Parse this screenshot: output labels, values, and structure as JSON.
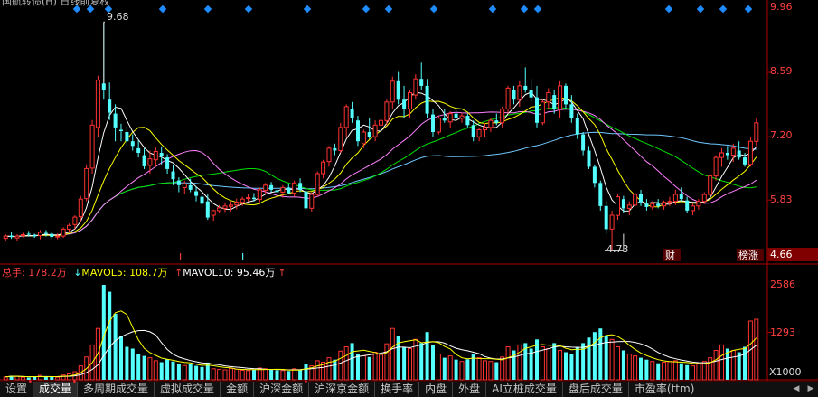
{
  "title": "国航转债(H) 日线前复权",
  "colors": {
    "up": "#ff3232",
    "down": "#54ffff",
    "axis": "#b00000",
    "ma5": "#ffffff",
    "ma10": "#ffff00",
    "ma20": "#ff80ff",
    "ma30": "#00e000",
    "ma60": "#6ec8ff"
  },
  "price_axis": {
    "top_label": "9.96",
    "ticks": [
      "8.59",
      "7.20",
      "5.83"
    ],
    "bottom_label": "4.66"
  },
  "annotations": {
    "high": "9.68",
    "low": "4.73"
  },
  "markers": {
    "L1": "L",
    "L2": "L"
  },
  "badges": {
    "cai": "财",
    "bang": "榜涨"
  },
  "volume_legend": {
    "total_label": "总手",
    "total_value": "178.2万",
    "ma5_label": "MAVOL5",
    "ma5_value": "108.7万",
    "ma10_label": "MAVOL10",
    "ma10_value": "95.46万"
  },
  "volume_axis": {
    "top_label": "2586",
    "mid_label": "1293",
    "unit_label": "X1000"
  },
  "tabs": [
    {
      "label": "设置",
      "marked": true
    },
    {
      "label": "成交量",
      "marked": true,
      "active": true
    },
    {
      "label": "多周期成交量",
      "marked": false
    },
    {
      "label": "虚拟成交量",
      "marked": false
    },
    {
      "label": "金额",
      "marked": false
    },
    {
      "label": "沪深金额",
      "marked": true
    },
    {
      "label": "沪深京金额",
      "marked": false
    },
    {
      "label": "换手率",
      "marked": false
    },
    {
      "label": "内盘",
      "marked": false
    },
    {
      "label": "外盘",
      "marked": false
    },
    {
      "label": "AI立桩成交量",
      "marked": false
    },
    {
      "label": "盘后成交量",
      "marked": false
    },
    {
      "label": "市盈率(ttm)",
      "marked": false
    }
  ],
  "scroll_icons": [
    "triangle-left-icon",
    "triangle-right-icon"
  ],
  "scroll_glyphs": [
    "◀",
    "▶"
  ],
  "chart_data": {
    "type": "candlestick",
    "price_range": [
      4.66,
      9.96
    ],
    "volume_range": [
      0,
      2586
    ],
    "candles": [
      [
        5.0,
        5.09,
        4.94,
        5.05
      ],
      [
        5.06,
        5.14,
        4.99,
        5.03
      ],
      [
        5.01,
        5.09,
        4.95,
        5.05
      ],
      [
        5.08,
        5.12,
        5.02,
        5.08
      ],
      [
        5.1,
        5.16,
        5.04,
        5.08
      ],
      [
        5.08,
        5.1,
        5.01,
        5.04
      ],
      [
        5.06,
        5.18,
        4.98,
        5.13
      ],
      [
        5.12,
        5.18,
        5.04,
        5.11
      ],
      [
        5.1,
        5.15,
        4.99,
        5.03
      ],
      [
        5.04,
        5.11,
        4.98,
        5.05
      ],
      [
        5.05,
        5.24,
        5.01,
        5.2
      ],
      [
        5.2,
        5.32,
        5.14,
        5.28
      ],
      [
        5.3,
        5.5,
        5.2,
        5.46
      ],
      [
        5.47,
        5.92,
        5.35,
        5.85
      ],
      [
        5.86,
        6.6,
        5.8,
        6.51
      ],
      [
        6.52,
        7.56,
        6.4,
        7.45
      ],
      [
        7.4,
        8.52,
        7.2,
        8.42
      ],
      [
        8.35,
        9.68,
        8.0,
        8.2
      ],
      [
        8.0,
        8.37,
        7.56,
        7.72
      ],
      [
        7.7,
        7.9,
        7.1,
        7.4
      ],
      [
        7.35,
        7.48,
        7.1,
        7.32
      ],
      [
        7.3,
        7.42,
        7.0,
        7.1
      ],
      [
        7.1,
        7.25,
        6.9,
        7.0
      ],
      [
        6.95,
        7.12,
        6.75,
        6.85
      ],
      [
        6.8,
        6.95,
        6.5,
        6.56
      ],
      [
        6.58,
        6.9,
        6.4,
        6.72
      ],
      [
        6.7,
        6.98,
        6.55,
        6.88
      ],
      [
        6.85,
        6.99,
        6.6,
        6.78
      ],
      [
        6.75,
        6.82,
        6.4,
        6.5
      ],
      [
        6.45,
        6.58,
        6.15,
        6.28
      ],
      [
        6.25,
        6.32,
        6.0,
        6.15
      ],
      [
        6.1,
        6.25,
        5.95,
        6.18
      ],
      [
        6.15,
        6.29,
        6.0,
        6.05
      ],
      [
        6.02,
        6.12,
        5.8,
        5.92
      ],
      [
        5.9,
        6.0,
        5.68,
        5.75
      ],
      [
        5.8,
        5.95,
        5.4,
        5.45
      ],
      [
        5.5,
        5.62,
        5.38,
        5.6
      ],
      [
        5.6,
        5.72,
        5.55,
        5.66
      ],
      [
        5.65,
        5.78,
        5.57,
        5.7
      ],
      [
        5.69,
        5.8,
        5.58,
        5.72
      ],
      [
        5.72,
        5.86,
        5.63,
        5.78
      ],
      [
        5.78,
        5.9,
        5.7,
        5.85
      ],
      [
        5.86,
        5.95,
        5.8,
        5.88
      ],
      [
        5.88,
        5.98,
        5.8,
        5.85
      ],
      [
        5.84,
        6.1,
        5.78,
        6.05
      ],
      [
        6.04,
        6.2,
        5.95,
        6.15
      ],
      [
        6.15,
        6.22,
        6.0,
        6.05
      ],
      [
        6.04,
        6.12,
        5.9,
        6.0
      ],
      [
        6.0,
        6.15,
        5.88,
        6.1
      ],
      [
        6.1,
        6.18,
        5.95,
        5.98
      ],
      [
        5.98,
        6.25,
        5.9,
        6.2
      ],
      [
        6.2,
        6.3,
        6.0,
        6.05
      ],
      [
        6.02,
        6.1,
        5.6,
        5.65
      ],
      [
        5.65,
        6.0,
        5.58,
        5.95
      ],
      [
        5.95,
        6.45,
        5.9,
        6.4
      ],
      [
        6.4,
        6.7,
        6.3,
        6.65
      ],
      [
        6.66,
        7.0,
        6.55,
        6.95
      ],
      [
        6.95,
        7.05,
        6.8,
        6.9
      ],
      [
        6.9,
        7.5,
        6.85,
        7.4
      ],
      [
        7.4,
        7.9,
        7.2,
        7.85
      ],
      [
        7.8,
        7.95,
        7.5,
        7.6
      ],
      [
        7.55,
        7.65,
        7.0,
        7.1
      ],
      [
        7.05,
        7.35,
        6.95,
        7.3
      ],
      [
        7.3,
        7.6,
        7.15,
        7.2
      ],
      [
        7.2,
        7.55,
        7.1,
        7.45
      ],
      [
        7.45,
        7.7,
        7.3,
        7.55
      ],
      [
        7.55,
        8.0,
        7.45,
        7.95
      ],
      [
        7.95,
        8.5,
        7.8,
        8.4
      ],
      [
        8.4,
        8.6,
        7.9,
        8.0
      ],
      [
        8.0,
        8.3,
        7.6,
        7.8
      ],
      [
        7.8,
        8.2,
        7.6,
        8.15
      ],
      [
        8.1,
        8.55,
        8.0,
        8.45
      ],
      [
        8.45,
        8.8,
        8.2,
        8.3
      ],
      [
        8.3,
        8.45,
        7.6,
        7.7
      ],
      [
        7.68,
        7.8,
        7.2,
        7.3
      ],
      [
        7.3,
        7.65,
        7.25,
        7.6
      ],
      [
        7.6,
        7.8,
        7.5,
        7.55
      ],
      [
        7.52,
        7.75,
        7.4,
        7.7
      ],
      [
        7.7,
        7.85,
        7.55,
        7.6
      ],
      [
        7.6,
        7.72,
        7.5,
        7.65
      ],
      [
        7.65,
        7.7,
        7.4,
        7.45
      ],
      [
        7.45,
        7.55,
        7.1,
        7.2
      ],
      [
        7.2,
        7.4,
        7.1,
        7.35
      ],
      [
        7.35,
        7.5,
        7.2,
        7.4
      ],
      [
        7.4,
        7.6,
        7.3,
        7.55
      ],
      [
        7.55,
        7.7,
        7.45,
        7.5
      ],
      [
        7.5,
        7.85,
        7.4,
        7.8
      ],
      [
        7.8,
        8.3,
        7.7,
        8.25
      ],
      [
        8.2,
        8.3,
        7.9,
        8.0
      ],
      [
        8.0,
        8.4,
        7.85,
        8.3
      ],
      [
        8.3,
        8.7,
        8.15,
        8.2
      ],
      [
        8.2,
        8.45,
        7.95,
        8.05
      ],
      [
        8.05,
        8.3,
        7.4,
        7.5
      ],
      [
        7.5,
        8.0,
        7.45,
        7.95
      ],
      [
        7.95,
        8.25,
        7.8,
        8.15
      ],
      [
        8.1,
        8.2,
        7.7,
        7.8
      ],
      [
        7.8,
        8.4,
        7.6,
        8.3
      ],
      [
        8.3,
        8.35,
        7.8,
        7.9
      ],
      [
        7.9,
        8.1,
        7.5,
        7.6
      ],
      [
        7.6,
        7.7,
        7.15,
        7.25
      ],
      [
        7.25,
        7.3,
        6.8,
        6.9
      ],
      [
        6.9,
        7.0,
        6.5,
        6.55
      ],
      [
        6.55,
        6.6,
        6.1,
        6.2
      ],
      [
        6.2,
        6.25,
        5.6,
        5.7
      ],
      [
        5.7,
        5.8,
        5.1,
        5.2
      ],
      [
        5.2,
        5.6,
        4.73,
        5.5
      ],
      [
        5.5,
        5.95,
        5.4,
        5.9
      ],
      [
        5.85,
        5.92,
        5.55,
        5.65
      ],
      [
        5.65,
        5.8,
        5.5,
        5.72
      ],
      [
        5.72,
        6.0,
        5.65,
        5.95
      ],
      [
        5.95,
        6.05,
        5.7,
        5.78
      ],
      [
        5.75,
        5.85,
        5.6,
        5.68
      ],
      [
        5.68,
        5.8,
        5.62,
        5.75
      ],
      [
        5.75,
        5.85,
        5.65,
        5.7
      ],
      [
        5.7,
        5.82,
        5.62,
        5.78
      ],
      [
        5.78,
        5.9,
        5.7,
        5.8
      ],
      [
        5.8,
        6.05,
        5.72,
        5.95
      ],
      [
        5.95,
        6.1,
        5.8,
        5.85
      ],
      [
        5.82,
        5.9,
        5.55,
        5.6
      ],
      [
        5.6,
        5.75,
        5.5,
        5.7
      ],
      [
        5.7,
        5.85,
        5.62,
        5.8
      ],
      [
        5.8,
        6.0,
        5.75,
        5.95
      ],
      [
        5.95,
        6.4,
        5.9,
        6.35
      ],
      [
        6.35,
        6.8,
        6.25,
        6.75
      ],
      [
        6.75,
        6.95,
        6.55,
        6.85
      ],
      [
        6.85,
        7.0,
        6.7,
        6.8
      ],
      [
        6.8,
        7.05,
        6.65,
        6.95
      ],
      [
        6.9,
        7.1,
        6.7,
        6.75
      ],
      [
        6.75,
        6.85,
        6.55,
        6.6
      ],
      [
        6.6,
        7.2,
        6.55,
        7.1
      ],
      [
        7.1,
        7.6,
        7.0,
        7.5
      ]
    ],
    "volume": [
      80,
      110,
      95,
      70,
      60,
      90,
      120,
      75,
      85,
      70,
      130,
      160,
      220,
      380,
      620,
      950,
      1400,
      2586,
      2400,
      1800,
      1200,
      900,
      850,
      700,
      650,
      600,
      520,
      480,
      560,
      500,
      430,
      390,
      420,
      380,
      350,
      470,
      300,
      280,
      270,
      310,
      290,
      260,
      250,
      270,
      320,
      300,
      280,
      260,
      250,
      240,
      300,
      280,
      420,
      380,
      520,
      480,
      600,
      550,
      780,
      900,
      1000,
      700,
      650,
      620,
      750,
      700,
      980,
      1400,
      1200,
      900,
      850,
      1100,
      1000,
      1300,
      950,
      700,
      600,
      650,
      550,
      500,
      560,
      700,
      600,
      520,
      500,
      480,
      620,
      900,
      800,
      950,
      1000,
      850,
      1100,
      900,
      850,
      1000,
      800,
      750,
      700,
      900,
      1000,
      1150,
      1300,
      1400,
      1200,
      1100,
      900,
      800,
      700,
      650,
      600,
      550,
      500,
      450,
      480,
      500,
      520,
      450,
      400,
      380,
      450,
      500,
      600,
      800,
      950,
      850,
      800,
      750,
      900,
      1600,
      1650
    ]
  }
}
